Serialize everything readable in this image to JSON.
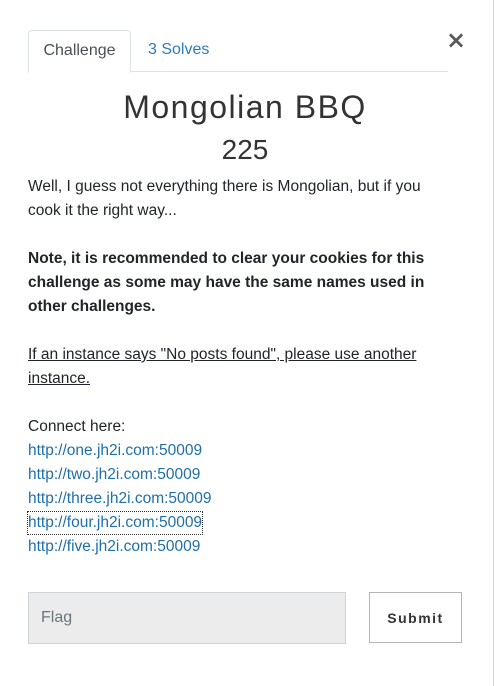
{
  "modal": {
    "close_label": "×",
    "tabs": [
      {
        "label": "Challenge",
        "active": true
      },
      {
        "label": "3 Solves",
        "active": false
      }
    ],
    "challenge": {
      "name": "Mongolian BBQ",
      "value": "225"
    },
    "description": {
      "intro": "Well, I guess not everything there is Mongolian, but if you cook it the right way...",
      "note": "Note, it is recommended to clear your cookies for this challenge as some may have the same names used in other challenges.",
      "instance_note": "If an instance says \"No posts found\", please use another instance.",
      "connect_label": "Connect here:",
      "links": [
        "http://one.jh2i.com:50009",
        "http://two.jh2i.com:50009",
        "http://three.jh2i.com:50009",
        "http://four.jh2i.com:50009",
        "http://five.jh2i.com:50009"
      ]
    },
    "form": {
      "flag_placeholder": "Flag",
      "flag_value": "",
      "submit_label": "Submit"
    },
    "colors": {
      "link": "#1f6fa8",
      "tab_link": "#2d7bbf",
      "input_bg": "#ececec"
    }
  }
}
